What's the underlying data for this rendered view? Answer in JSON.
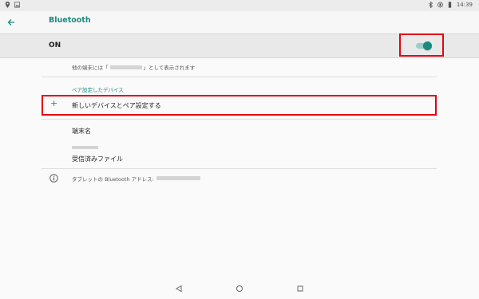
{
  "status_bar": {
    "time": "14:39",
    "left_icons": [
      "location-icon",
      "image-icon"
    ],
    "right_icons": [
      "bluetooth-icon",
      "vibrate-icon",
      "battery-icon"
    ]
  },
  "app_bar": {
    "title": "Bluetooth"
  },
  "master_switch": {
    "label": "ON",
    "state": "on",
    "accent_color": "#1a8a7e"
  },
  "visibility": {
    "prefix": "他の端末には「",
    "suffix": "」として表示されます"
  },
  "paired_devices": {
    "header": "ペア設定したデバイス",
    "pair_new_label": "新しいデバイスとペア設定する"
  },
  "device_name": {
    "label": "端末名"
  },
  "received_files": {
    "label": "受信済みファイル"
  },
  "address_info": {
    "text": "タブレットの Bluetooth アドレス:"
  },
  "nav_bar": {
    "buttons": [
      "back-icon",
      "home-icon",
      "recents-icon"
    ]
  },
  "highlight_color": "#e60012"
}
